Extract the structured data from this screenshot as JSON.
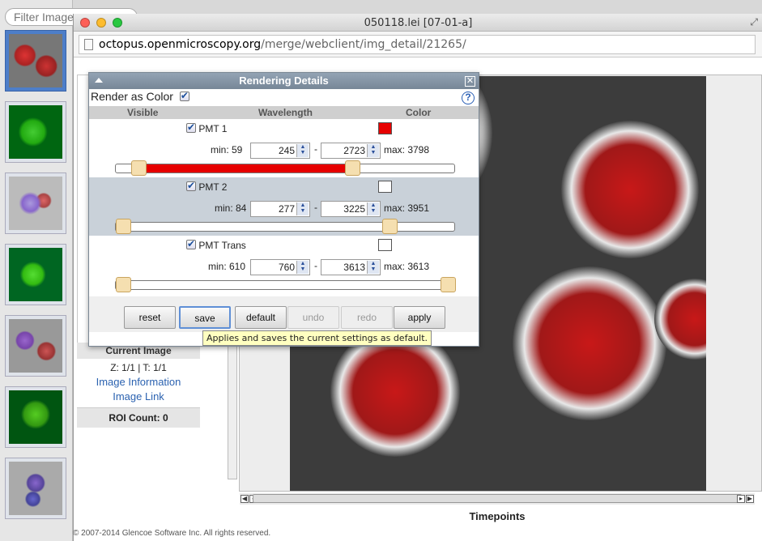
{
  "filter": {
    "placeholder": "Filter Images"
  },
  "window": {
    "title": "050118.lei [07-01-a]"
  },
  "url": {
    "host": "octopus.openmicroscopy.org",
    "path": "/merge/webclient/img_detail/21265/"
  },
  "left_panel": {
    "header": "Current Image",
    "zt": "Z: 1/1 | T: 1/1",
    "image_information": "Image Information",
    "image_link": "Image Link",
    "roi_count": "ROI Count: 0"
  },
  "viewer": {
    "timepoints_label": "Timepoints"
  },
  "footer": {
    "copyright": "© 2007-2014 Glencoe Software Inc. All rights reserved."
  },
  "dialog": {
    "title": "Rendering Details",
    "render_as_color": "Render as Color",
    "columns": {
      "visible": "Visible",
      "wavelength": "Wavelength",
      "color": "Color"
    },
    "channels": [
      {
        "name": "PMT 1",
        "min_label": "min: 59",
        "start": "245",
        "end": "2723",
        "max_label": "max: 3798",
        "color": "#e60000",
        "fill": true,
        "window_start": 0.048,
        "window_end": 0.706
      },
      {
        "name": "PMT 2",
        "min_label": "min: 84",
        "start": "277",
        "end": "3225",
        "max_label": "max: 3951",
        "color": "#ffffff",
        "fill": false,
        "window_start": 0.0,
        "window_end": 0.82
      },
      {
        "name": "PMT Trans",
        "min_label": "min: 610",
        "start": "760",
        "end": "3613",
        "max_label": "max: 3613",
        "color": "#ffffff",
        "fill": false,
        "window_start": 0.0,
        "window_end": 1.0
      }
    ],
    "buttons": {
      "reset": "reset",
      "save": "save",
      "default": "default",
      "undo": "undo",
      "redo": "redo",
      "apply": "apply"
    },
    "tooltip": "Applies and saves the current settings as default."
  }
}
